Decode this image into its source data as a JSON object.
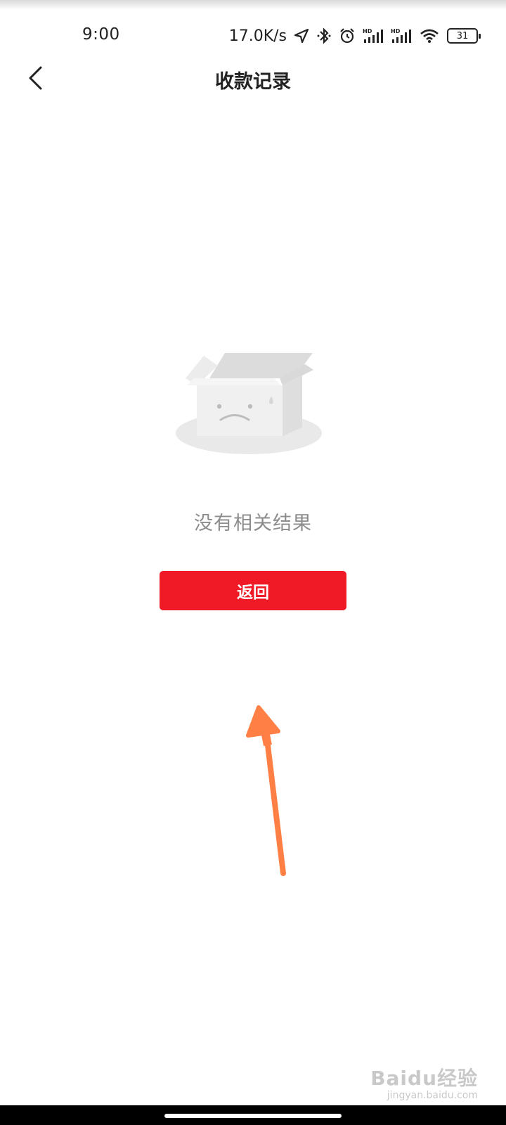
{
  "status_bar": {
    "time": "9:00",
    "net_speed": "17.0K/s",
    "battery": "31",
    "icons": [
      "location-icon",
      "bluetooth-icon",
      "alarm-icon",
      "signal-hd-icon",
      "signal-hd-icon",
      "wifi-icon",
      "battery-icon"
    ]
  },
  "nav": {
    "back_icon": "chevron-left-icon",
    "title": "收款记录"
  },
  "empty_state": {
    "illustration": "empty-box-icon",
    "message": "没有相关结果"
  },
  "actions": {
    "return_label": "返回"
  },
  "watermark": {
    "brand": "Baidu经验",
    "url": "jingyan.baidu.com"
  },
  "colors": {
    "accent": "#ef1a25",
    "arrow": "#ff7f45",
    "muted_text": "#8c8c8c"
  }
}
